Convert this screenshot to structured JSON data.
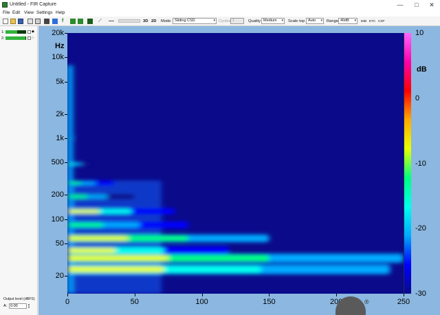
{
  "window": {
    "title": "Untitled - FIR Capture",
    "controls": {
      "minimize": "—",
      "maximize": "□",
      "close": "✕"
    }
  },
  "menu": [
    "File",
    "Edit",
    "View",
    "Settings",
    "Help"
  ],
  "toolbar": {
    "view_3d": "3D",
    "view_2d": "2D",
    "mode_label": "Mode",
    "mode_value": "Sliding CSD",
    "cycles_label": "Cycles",
    "cycles_value": "1",
    "quality_label": "Quality",
    "quality_value": "Medium",
    "scaletop_label": "Scale top",
    "scaletop_value": "Auto",
    "range_label": "Range",
    "range_value": "40dB",
    "buttons": [
      "IMB",
      "ETC",
      "CSP"
    ],
    "icons": [
      "new-icon",
      "open-icon",
      "save-icon",
      "copy-icon",
      "print-icon",
      "capture-icon",
      "filter-icon",
      "wave-icon",
      "plot-icon",
      "arrow-icon",
      "cursor-icon",
      "slider-icon"
    ]
  },
  "channels": [
    {
      "number": "1:",
      "level": 0.55,
      "color": "#2fb33a"
    },
    {
      "number": "2:",
      "level": 0.95,
      "color": "#2fb33a"
    }
  ],
  "output": {
    "label": "Output level (dBFS)",
    "channel": "A:",
    "value": "0.00"
  },
  "chart_data": {
    "type": "heatmap",
    "title": "",
    "xlabel": "",
    "ylabel": "",
    "y_unit_label": "Hz",
    "y_scale": "log",
    "x_ticks": [
      "0",
      "50",
      "100",
      "150",
      "200",
      "250"
    ],
    "x_range": [
      0,
      250
    ],
    "y_ticks": [
      "20k",
      "10k",
      "5k",
      "2k",
      "1k",
      "500",
      "200",
      "100",
      "50",
      "20"
    ],
    "y_range": [
      12,
      20000
    ],
    "colorbar": {
      "unit_label": "dB",
      "ticks": [
        "10",
        "0",
        "-10",
        "-20",
        "-30"
      ],
      "range": [
        -30,
        10
      ],
      "colors": [
        "#0a0a8a",
        "#0000ff",
        "#00aaff",
        "#00ffee",
        "#00ff80",
        "#e8ff00",
        "#ffaa00",
        "#ff0000",
        "#ff00aa",
        "#ff66ff"
      ]
    },
    "background_level_db": -30,
    "ridges": [
      {
        "freq_hz": 24,
        "peak_db": -8,
        "decay_x": 240
      },
      {
        "freq_hz": 33,
        "peak_db": -6,
        "decay_x": 250
      },
      {
        "freq_hz": 41,
        "peak_db": -10,
        "decay_x": 120
      },
      {
        "freq_hz": 58,
        "peak_db": -7,
        "decay_x": 150
      },
      {
        "freq_hz": 85,
        "peak_db": -12,
        "decay_x": 90
      },
      {
        "freq_hz": 125,
        "peak_db": -10,
        "decay_x": 80
      },
      {
        "freq_hz": 190,
        "peak_db": -14,
        "decay_x": 50
      },
      {
        "freq_hz": 280,
        "peak_db": -13,
        "decay_x": 35
      },
      {
        "freq_hz": 480,
        "peak_db": -15,
        "decay_x": 18
      },
      {
        "freq_hz": 1000,
        "peak_db": -18,
        "decay_x": 8
      }
    ]
  }
}
